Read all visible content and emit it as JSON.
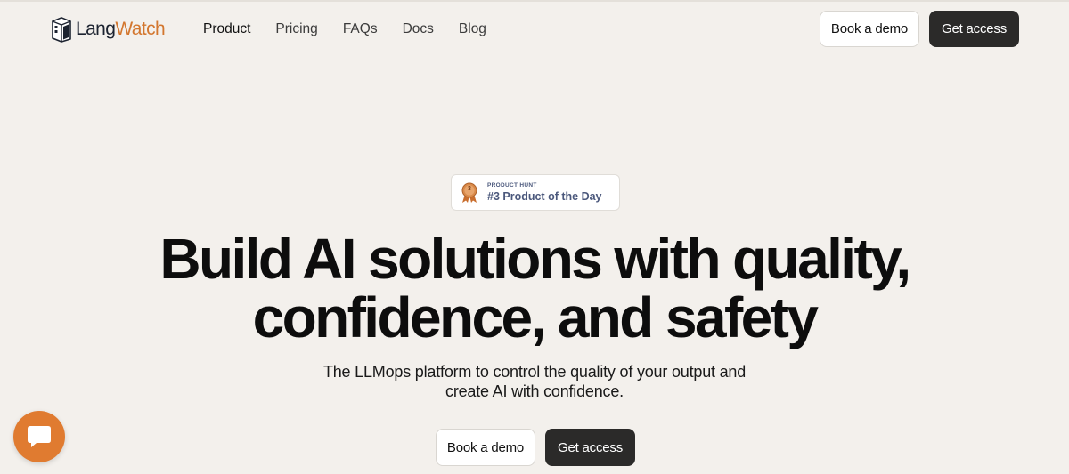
{
  "brand": {
    "name_part1": "Lang",
    "name_part2": "Watch",
    "color_primary": "#1c2330",
    "color_accent": "#d3772f"
  },
  "nav": {
    "items": [
      {
        "label": "Product"
      },
      {
        "label": "Pricing"
      },
      {
        "label": "FAQs"
      },
      {
        "label": "Docs"
      },
      {
        "label": "Blog"
      }
    ],
    "active": "Product"
  },
  "header_buttons": {
    "demo_label": "Book a demo",
    "access_label": "Get access"
  },
  "badge": {
    "kicker": "PRODUCT HUNT",
    "title": "#3 Product of the Day",
    "rank": "3",
    "icon": "medal-icon",
    "color": "#4b587c"
  },
  "hero": {
    "title_line1": "Build AI solutions with quality,",
    "title_line2": "confidence, and safety",
    "subtitle_line1": "The LLMops platform to control the quality of your output and",
    "subtitle_line2": "create AI with confidence.",
    "demo_label": "Book a demo",
    "access_label": "Get access"
  },
  "chat_widget": {
    "icon": "chat-bubble-icon",
    "color": "#e07b30"
  },
  "colors": {
    "background": "#f3f0ec",
    "dark_button": "#2b2a29",
    "light_button": "#ffffff"
  }
}
